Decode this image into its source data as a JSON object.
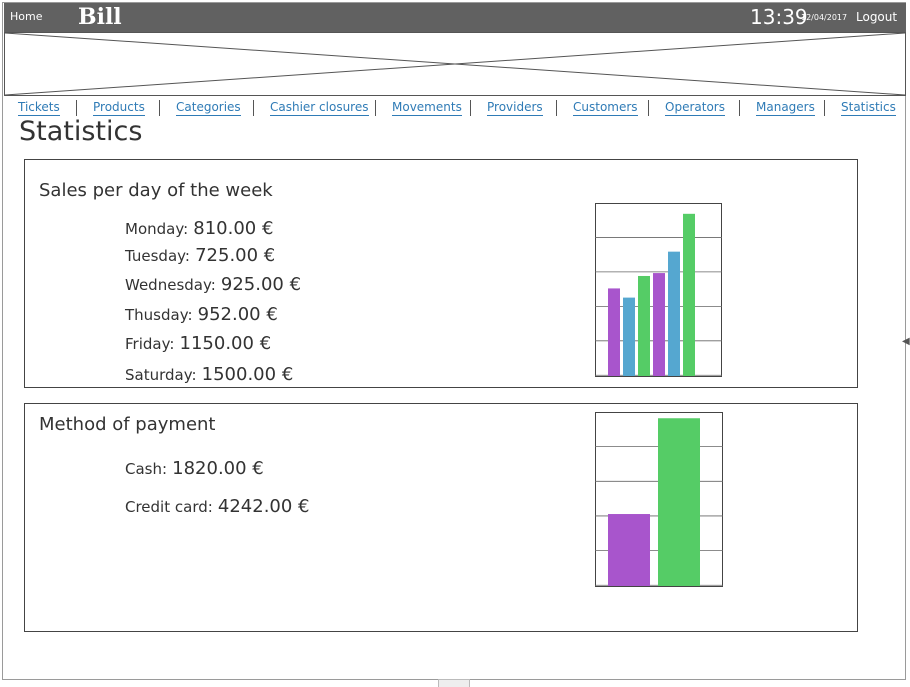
{
  "header": {
    "home_label": "Home",
    "app_title": "Bill",
    "time": "13:39",
    "date": "12/04/2017",
    "logout_label": "Logout"
  },
  "nav": {
    "items": [
      {
        "label": "Tickets"
      },
      {
        "label": "Products"
      },
      {
        "label": "Categories"
      },
      {
        "label": "Cashier closures"
      },
      {
        "label": "Movements"
      },
      {
        "label": "Providers"
      },
      {
        "label": "Customers"
      },
      {
        "label": "Operators"
      },
      {
        "label": "Managers"
      },
      {
        "label": "Statistics"
      }
    ]
  },
  "page": {
    "title": "Statistics"
  },
  "sales_panel": {
    "title": "Sales per day of the week",
    "days": [
      {
        "label": "Monday:",
        "value": "810.00 €"
      },
      {
        "label": "Tuesday:",
        "value": "725.00 €"
      },
      {
        "label": "Wednesday:",
        "value": "925.00 €"
      },
      {
        "label": "Thusday:",
        "value": "952.00 €"
      },
      {
        "label": "Friday:",
        "value": "1150.00 €"
      },
      {
        "label": "Saturday:",
        "value": "1500.00 €"
      }
    ]
  },
  "payment_panel": {
    "title": "Method of payment",
    "methods": [
      {
        "label": "Cash:",
        "value": "1820.00 €"
      },
      {
        "label": "Credit card:",
        "value": "4242.00 €"
      }
    ]
  },
  "colors": {
    "purple": "#a855cc",
    "blue": "#55a7d0",
    "green": "#55cc66",
    "topbar": "#616161",
    "link": "#2f7bb6"
  },
  "chart_data": [
    {
      "type": "bar",
      "categories": [
        "Monday",
        "Tuesday",
        "Wednesday",
        "Thusday",
        "Friday",
        "Saturday"
      ],
      "values": [
        810,
        725,
        925,
        952,
        1150,
        1500
      ],
      "colors": [
        "#a855cc",
        "#55a7d0",
        "#55cc66",
        "#a855cc",
        "#55a7d0",
        "#55cc66"
      ],
      "ylim": [
        0,
        1600
      ],
      "title": "",
      "xlabel": "",
      "ylabel": "",
      "grid": true
    },
    {
      "type": "bar",
      "categories": [
        "Cash",
        "Credit card"
      ],
      "values": [
        1820,
        4242
      ],
      "colors": [
        "#a855cc",
        "#55cc66"
      ],
      "ylim": [
        0,
        4400
      ],
      "title": "",
      "xlabel": "",
      "ylabel": "",
      "grid": true
    }
  ]
}
